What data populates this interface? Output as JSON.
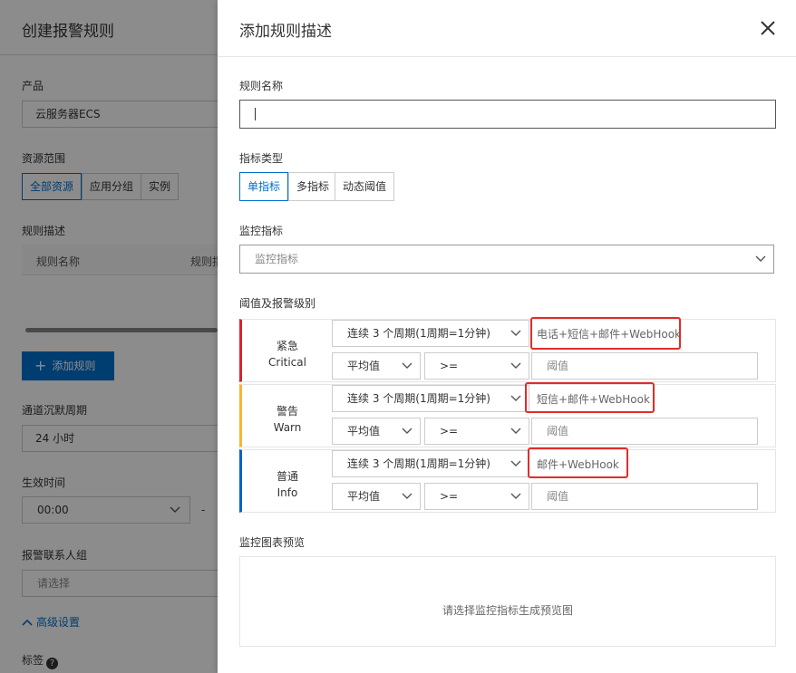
{
  "bg": {
    "title": "创建报警规则",
    "product_label": "产品",
    "product_value": "云服务器ECS",
    "scope_label": "资源范围",
    "scope_options": [
      "全部资源",
      "应用分组",
      "实例"
    ],
    "rule_desc_label": "规则描述",
    "table_headers": [
      "规则名称",
      "规则指"
    ],
    "add_rule": "添加规则",
    "silence_label": "通道沉默周期",
    "silence_value": "24 小时",
    "effective_label": "生效时间",
    "effective_value": "00:00",
    "effective_sep": "-",
    "contact_label": "报警联系人组",
    "contact_placeholder": "请选择",
    "advanced": "高级设置",
    "tag_label": "标签"
  },
  "drawer": {
    "title": "添加规则描述",
    "rule_name_label": "规则名称",
    "rule_name_value": "",
    "metric_type_label": "指标类型",
    "metric_types": [
      "单指标",
      "多指标",
      "动态阈值"
    ],
    "metric_type_selected": "单指标",
    "metric_label": "监控指标",
    "metric_placeholder": "监控指标",
    "threshold_label": "阈值及报警级别",
    "levels": [
      {
        "name": "紧急",
        "name_en": "Critical",
        "color": "#d9232d",
        "period": "连续 3 个周期(1周期=1分钟)",
        "notify": "电话+短信+邮件+WebHook",
        "stat": "平均值",
        "op": ">=",
        "threshold_placeholder": "阈值"
      },
      {
        "name": "警告",
        "name_en": "Warn",
        "color": "#f5b62d",
        "period": "连续 3 个周期(1周期=1分钟)",
        "notify": "短信+邮件+WebHook",
        "stat": "平均值",
        "op": ">=",
        "threshold_placeholder": "阈值"
      },
      {
        "name": "普通",
        "name_en": "Info",
        "color": "#0064c8",
        "period": "连续 3 个周期(1周期=1分钟)",
        "notify": "邮件+WebHook",
        "stat": "平均值",
        "op": ">=",
        "threshold_placeholder": "阈值"
      }
    ],
    "preview_label": "监控图表预览",
    "preview_empty": "请选择监控指标生成预览图"
  },
  "colors": {
    "accent": "#0070cc",
    "highlight": "#e02c2c"
  }
}
